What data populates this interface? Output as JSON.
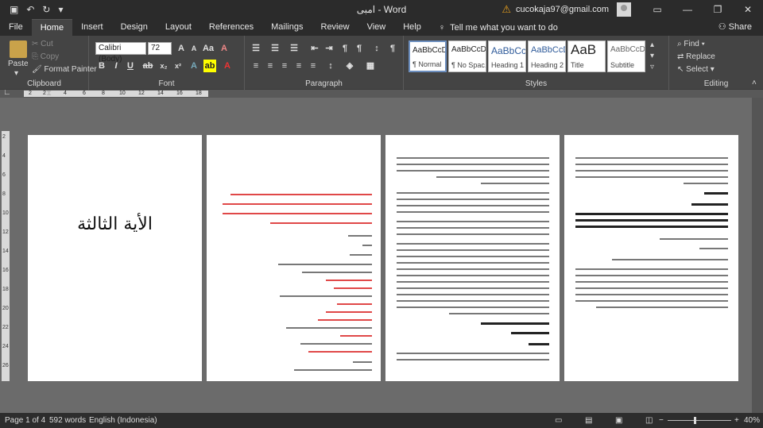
{
  "titlebar": {
    "doc_title": "امبی  -  Word",
    "email": "cucokaja97@gmail.com",
    "warning_icon": "warning-icon",
    "buttons": [
      "minimize",
      "restore",
      "close"
    ]
  },
  "tabs": [
    "File",
    "Home",
    "Insert",
    "Design",
    "Layout",
    "References",
    "Mailings",
    "Review",
    "View",
    "Help"
  ],
  "tell_me": "Tell me what you want to do",
  "share": "Share",
  "ribbon": {
    "clipboard": {
      "paste": "Paste",
      "cut": "Cut",
      "copy": "Copy",
      "format_painter": "Format Painter",
      "label": "Clipboard"
    },
    "font": {
      "name": "Calibri (Body)",
      "size": "72",
      "label": "Font"
    },
    "paragraph": {
      "label": "Paragraph"
    },
    "styles": {
      "label": "Styles",
      "items": [
        {
          "preview": "AaBbCcDc",
          "name": "¶ Normal"
        },
        {
          "preview": "AaBbCcDc",
          "name": "¶ No Spac..."
        },
        {
          "preview": "AaBbCc",
          "name": "Heading 1"
        },
        {
          "preview": "AaBbCcD",
          "name": "Heading 2"
        },
        {
          "preview": "AaB",
          "name": "Title"
        },
        {
          "preview": "AaBbCcD",
          "name": "Subtitle"
        }
      ]
    },
    "editing": {
      "find": "Find",
      "replace": "Replace",
      "select": "Select",
      "label": "Editing"
    }
  },
  "ruler": {
    "numbers": [
      "2",
      "2",
      "4",
      "6",
      "8",
      "10",
      "12",
      "14",
      "16",
      "18"
    ]
  },
  "vruler": {
    "numbers": [
      "2",
      "4",
      "6",
      "8",
      "10",
      "12",
      "14",
      "16",
      "18",
      "20",
      "22",
      "24",
      "26"
    ]
  },
  "pages": {
    "page1_heading": "الأية الثالثة"
  },
  "status": {
    "page": "Page 1 of 4",
    "words": "592 words",
    "language": "English (Indonesia)",
    "zoom": "40%"
  }
}
